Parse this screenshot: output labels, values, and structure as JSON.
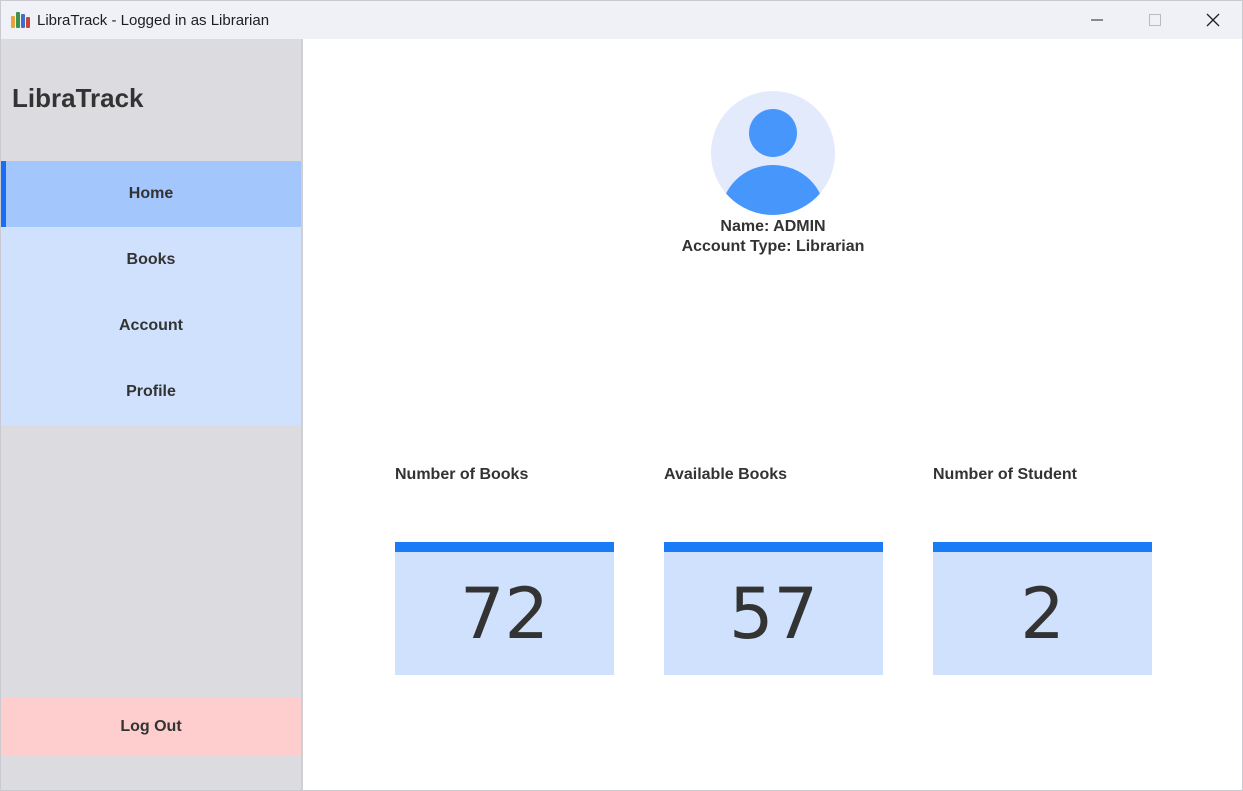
{
  "window": {
    "title": "LibraTrack - Logged in as Librarian"
  },
  "sidebar": {
    "brand": "LibraTrack",
    "items": [
      {
        "label": "Home",
        "active": true
      },
      {
        "label": "Books",
        "active": false
      },
      {
        "label": "Account",
        "active": false
      },
      {
        "label": "Profile",
        "active": false
      }
    ],
    "logout_label": "Log Out"
  },
  "profile": {
    "name": "Name: ADMIN",
    "account_type": "Account Type: Librarian"
  },
  "stats": [
    {
      "label": "Number of Books",
      "value": "72"
    },
    {
      "label": "Available Books",
      "value": "57"
    },
    {
      "label": "Number of Student",
      "value": "2"
    }
  ],
  "colors": {
    "accent": "#1a7bf7",
    "nav_active": "#a3c6fd",
    "nav_bg": "#cfe1fd",
    "logout_bg": "#fecece",
    "sidebar_bg": "#dcdbdf",
    "avatar_bg": "#e2eafc",
    "avatar_fg": "#4796fc"
  },
  "icons": {
    "app": "books-icon",
    "avatar": "user-avatar-icon",
    "minimize": "minimize-icon",
    "maximize": "maximize-icon",
    "close": "close-icon"
  }
}
